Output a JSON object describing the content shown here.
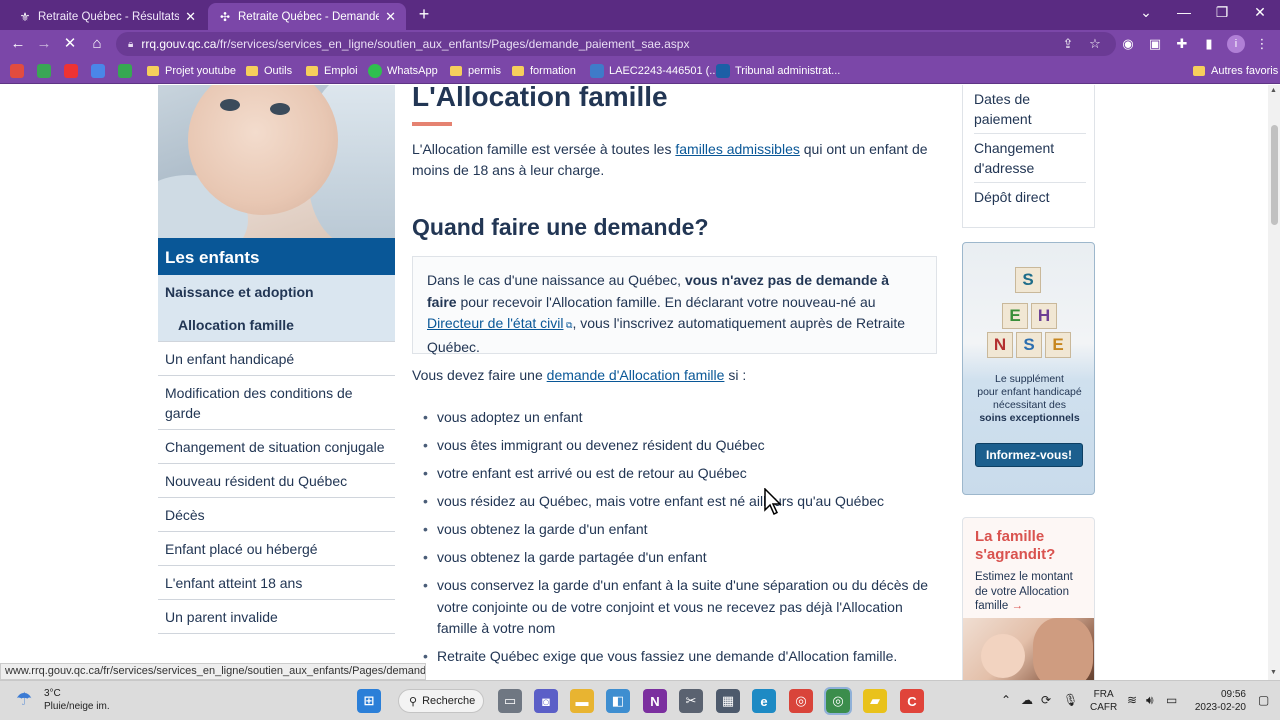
{
  "browser": {
    "tabs": [
      {
        "title": "Retraite Québec - Résultats de la",
        "active": false
      },
      {
        "title": "Retraite Québec - Demande d'Al",
        "active": true
      }
    ],
    "url_host": "rrq.gouv.qc.ca",
    "url_path": "/fr/services/services_en_ligne/soutien_aux_enfants/Pages/demande_paiement_sae.aspx",
    "bookmarks": [
      {
        "label": "Projet youtube",
        "icon": "folder-icon"
      },
      {
        "label": "Outils",
        "icon": "folder-icon"
      },
      {
        "label": "Emploi",
        "icon": "folder-icon"
      },
      {
        "label": "WhatsApp",
        "icon": "whatsapp-icon"
      },
      {
        "label": "permis",
        "icon": "folder-icon"
      },
      {
        "label": "formation",
        "icon": "folder-icon"
      },
      {
        "label": "LAEC2243-446501 (...",
        "icon": "document-icon"
      },
      {
        "label": "Tribunal administrat...",
        "icon": "quebec-flag-icon"
      }
    ],
    "other_bookmarks": "Autres favoris",
    "status_url": "www.rrq.gouv.qc.ca/fr/services/services_en_ligne/soutien_aux_enfants/Pages/demande_paiement_sae.aspx"
  },
  "sidebar": {
    "heading": "Les enfants",
    "items": [
      "Naissance et adoption",
      "Allocation famille",
      "Un enfant handicapé",
      "Modification des conditions de garde",
      "Changement de situation conjugale",
      "Nouveau résident du Québec",
      "Décès",
      "Enfant placé ou hébergé",
      "L'enfant atteint 18 ans",
      "Un parent invalide"
    ]
  },
  "main": {
    "title": "L'Allocation famille",
    "intro_before": "L'Allocation famille est versée à toutes les ",
    "intro_link": "familles admissibles",
    "intro_after": " qui ont un enfant de moins de 18 ans à leur charge.",
    "section_title": "Quand faire une demande?",
    "note_before": "Dans le cas d'une naissance au Québec, ",
    "note_bold": "vous n'avez pas de demande à faire",
    "note_mid": " pour recevoir l'Allocation famille. En déclarant votre nouveau-né au ",
    "note_link": "Directeur de l'état civil",
    "note_after": ", vous l'inscrivez automatiquement auprès de Retraite Québec.",
    "p2_before": "Vous devez faire une ",
    "p2_link": "demande d'Allocation famille",
    "p2_after": " si :",
    "bullets": [
      "vous adoptez un enfant",
      "vous êtes immigrant ou devenez résident du Québec",
      "votre enfant est arrivé ou est de retour au Québec",
      "vous résidez au Québec, mais votre enfant est né ailleurs qu'au Québec",
      "vous obtenez la garde d'un enfant",
      "vous obtenez la garde partagée d'un enfant",
      "vous conservez la garde d'un enfant à la suite d'une séparation ou du décès de votre conjointe ou de votre conjoint et vous ne recevez pas déjà l'Allocation famille à votre nom",
      "Retraite Québec exige que vous fassiez une demande d'Allocation famille."
    ]
  },
  "right": {
    "nav": [
      "Dates de paiement",
      "Changement d'adresse",
      "Dépôt direct"
    ],
    "promo1": {
      "line1": "Le supplément",
      "line2": "pour enfant handicapé",
      "line3": "nécessitant des",
      "line4_bold": "soins exceptionnels",
      "button": "Informez-vous!",
      "blocks": [
        "S",
        "E",
        "H",
        "N",
        "S",
        "E"
      ]
    },
    "promo2": {
      "heading": "La famille s'agrandit?",
      "text": "Estimez le montant de votre Allocation famille",
      "arrow": "→"
    }
  },
  "taskbar": {
    "temperature": "3°C",
    "weather": "Pluie/neige im.",
    "search": "Recherche",
    "lang1": "FRA",
    "lang2": "CAFR",
    "time": "09:56",
    "date": "2023-02-20"
  },
  "colors": {
    "chrome_dark": "#5a2b82",
    "chrome": "#7b47a8",
    "brand_blue": "#095797",
    "text": "#223654",
    "accent_red": "#e58271"
  }
}
